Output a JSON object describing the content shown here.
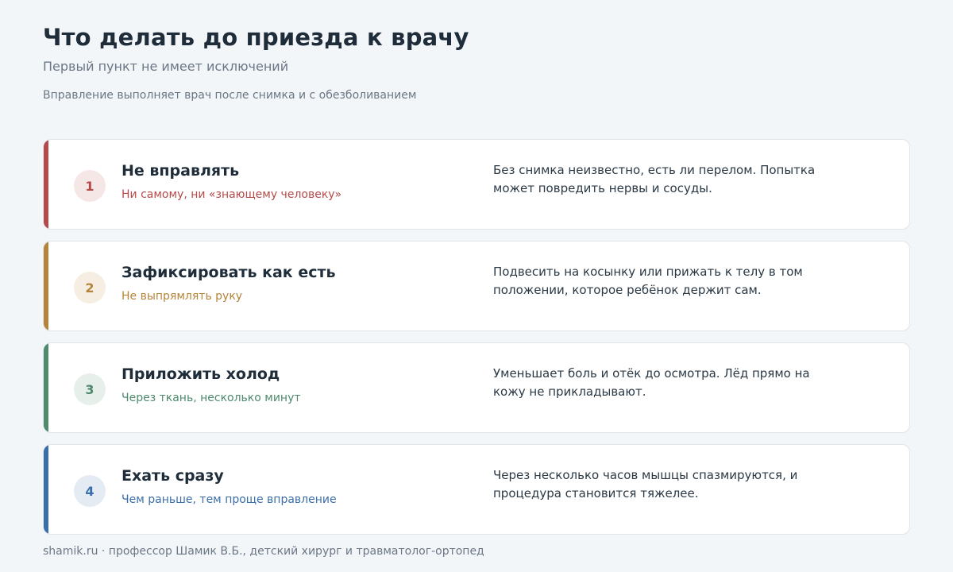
{
  "header": {
    "title": "Что делать до приезда к врачу",
    "subtitle": "Первый пункт не имеет исключений",
    "note": "Вправление выполняет врач после снимка и с обезболиванием"
  },
  "steps": [
    {
      "number": "1",
      "title": "Не вправлять",
      "subtitle": "Ни самому, ни «знающему человеку»",
      "description": "Без снимка неизвестно, есть ли перелом. Попытка может повредить нервы и сосуды.",
      "color": "#b54a4a",
      "circle_bg": "#f6e7e7"
    },
    {
      "number": "2",
      "title": "Зафиксировать как есть",
      "subtitle": "Не выпрямлять руку",
      "description": "Подвесить на косынку или прижать к телу в том положении, которое ребёнок держит сам.",
      "color": "#b5843a",
      "circle_bg": "#f6eee2"
    },
    {
      "number": "3",
      "title": "Приложить холод",
      "subtitle": "Через ткань, несколько минут",
      "description": "Уменьшает боль и отёк до осмотра. Лёд прямо на кожу не прикладывают.",
      "color": "#4e8a6c",
      "circle_bg": "#e6efea"
    },
    {
      "number": "4",
      "title": "Ехать сразу",
      "subtitle": "Чем раньше, тем проще вправление",
      "description": "Через несколько часов мышцы спазмируются, и процедура становится тяжелее.",
      "color": "#3a6ea8",
      "circle_bg": "#e4ebf3"
    }
  ],
  "footer": "shamik.ru · профессор Шамик В.Б., детский хирург и травматолог-ортопед"
}
